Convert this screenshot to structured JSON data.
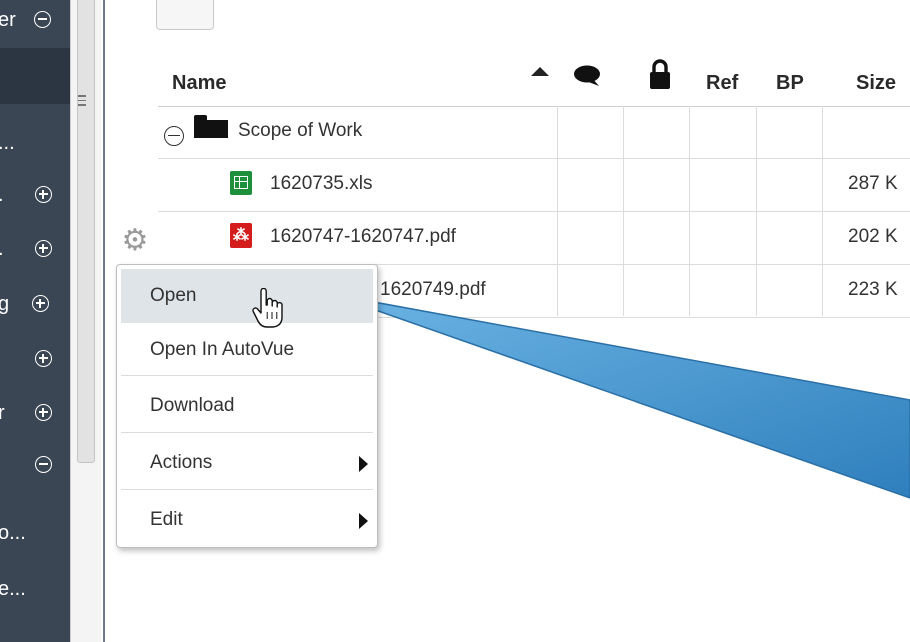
{
  "sidebar": {
    "rows": [
      {
        "label": "er",
        "toggle": "collapse"
      },
      {
        "label": "...",
        "toggle": ""
      },
      {
        "label": ".",
        "toggle": "expand"
      },
      {
        "label": ".",
        "toggle": "expand"
      },
      {
        "label": "g",
        "toggle": "expand"
      },
      {
        "label": "",
        "toggle": "expand"
      },
      {
        "label": "r",
        "toggle": "expand"
      },
      {
        "label": "",
        "toggle": "collapse"
      },
      {
        "label": "o...",
        "toggle": ""
      },
      {
        "label": "e...",
        "toggle": ""
      }
    ]
  },
  "table": {
    "columns": {
      "name": "Name",
      "comments_icon": "speech-bubble-icon",
      "lock_icon": "lock-icon",
      "ref": "Ref",
      "bp": "BP",
      "size": "Size"
    },
    "folder": {
      "name": "Scope of Work",
      "toggle": "collapse"
    },
    "files": [
      {
        "name": "1620735.xls",
        "type": "xls",
        "size": "287 K"
      },
      {
        "name": "1620747-1620747.pdf",
        "type": "pdf",
        "size": "202 K"
      },
      {
        "name": "1620749.pdf",
        "type": "pdf",
        "size": "223 K"
      }
    ]
  },
  "menu": {
    "items": [
      {
        "label": "Open",
        "highlighted": true,
        "submenu": false
      },
      {
        "label": "Open In AutoVue",
        "highlighted": false,
        "submenu": false
      },
      {
        "label": "Download",
        "highlighted": false,
        "submenu": false
      },
      {
        "label": "Actions",
        "highlighted": false,
        "submenu": true
      },
      {
        "label": "Edit",
        "highlighted": false,
        "submenu": true
      }
    ]
  },
  "icons": {
    "gear": "gear-icon",
    "cursor": "hand-pointer-icon",
    "sort": "sort-ascending-icon"
  },
  "colors": {
    "sidebar_bg": "#3b4655",
    "menu_highlight": "#dfe4e8",
    "callout": "#3d8fc9",
    "xls": "#1e8f3a",
    "pdf": "#d51c1c"
  }
}
